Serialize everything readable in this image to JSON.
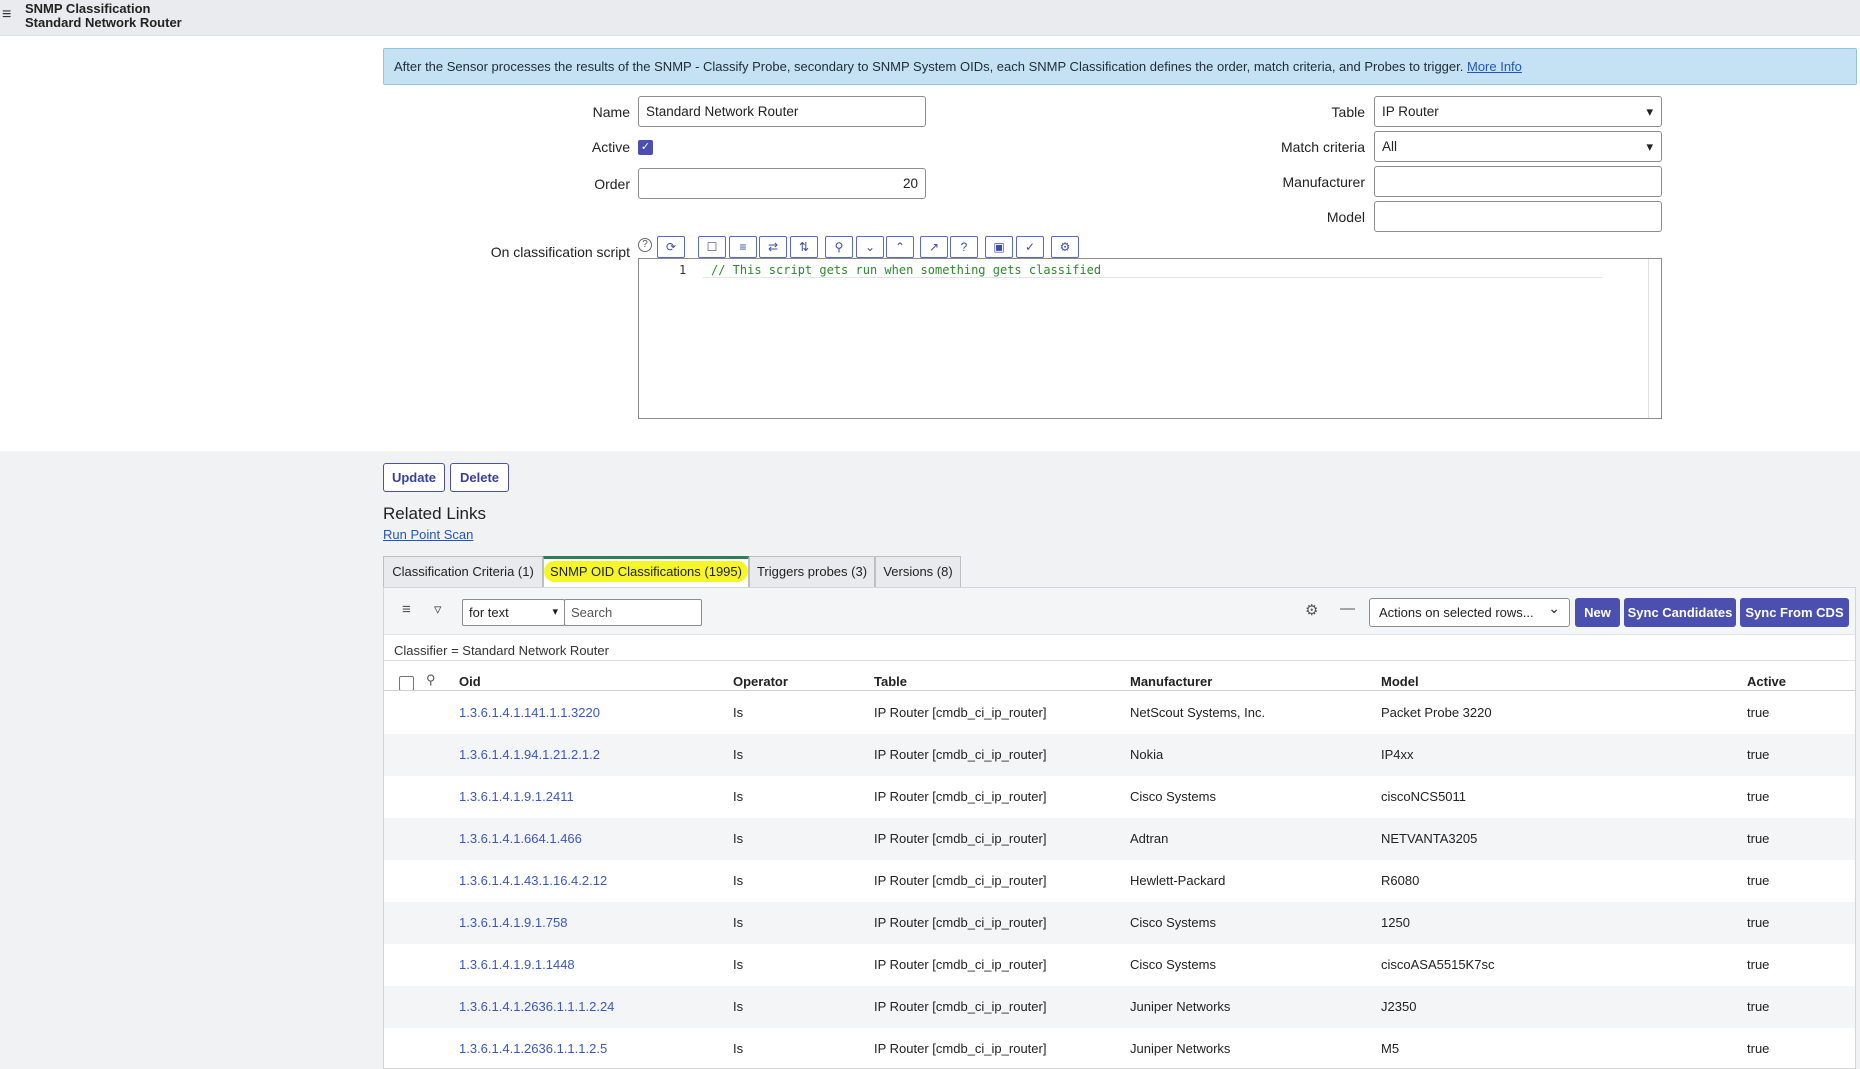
{
  "header": {
    "title": "SNMP Classification",
    "subtitle": "Standard Network Router",
    "menu_icon": "menu-icon"
  },
  "info": {
    "text": "After the Sensor processes the results of the SNMP - Classify Probe, secondary to SNMP System OIDs, each SNMP Classification defines the order, match criteria, and Probes to trigger. ",
    "link": "More Info"
  },
  "form": {
    "name_label": "Name",
    "name_value": "Standard Network Router",
    "active_label": "Active",
    "active_checked": true,
    "order_label": "Order",
    "order_value": "20",
    "table_label": "Table",
    "table_value": "IP Router",
    "match_label": "Match criteria",
    "match_value": "All",
    "manufacturer_label": "Manufacturer",
    "manufacturer_value": "",
    "model_label": "Model",
    "model_value": "",
    "script_label": "On classification script",
    "script_line_number": "1",
    "script_code": "// This script gets run when something gets classified",
    "toolbar_icons": [
      "script-debugger-icon",
      "comment-icon",
      "format-icon",
      "replace-icon",
      "replace-all-icon",
      "search-icon",
      "collapse-icon",
      "expand-icon",
      "fullscreen-icon",
      "help-icon",
      "save-icon",
      "syntax-check-icon",
      "settings-icon"
    ]
  },
  "buttons": {
    "update": "Update",
    "delete": "Delete"
  },
  "related": {
    "title": "Related Links",
    "link": "Run Point Scan"
  },
  "tabs": [
    {
      "label": "Classification Criteria (1)",
      "active": false
    },
    {
      "label": "SNMP OID Classifications (1995)",
      "active": true
    },
    {
      "label": "Triggers probes (3)",
      "active": false
    },
    {
      "label": "Versions (8)",
      "active": false
    }
  ],
  "list": {
    "search_field": "for text",
    "search_placeholder": "Search",
    "actions": "Actions on selected rows...",
    "new": "New",
    "sync_candidates": "Sync Candidates",
    "sync_from_cds": "Sync From CDS",
    "breadcrumb": "Classifier = Standard Network Router",
    "columns": [
      "Oid",
      "Operator",
      "Table",
      "Manufacturer",
      "Model",
      "Active"
    ],
    "rows": [
      {
        "oid": "1.3.6.1.4.1.141.1.1.3220",
        "operator": "Is",
        "table": "IP Router [cmdb_ci_ip_router]",
        "manufacturer": "NetScout Systems, Inc.",
        "model": "Packet Probe 3220",
        "active": "true"
      },
      {
        "oid": "1.3.6.1.4.1.94.1.21.2.1.2",
        "operator": "Is",
        "table": "IP Router [cmdb_ci_ip_router]",
        "manufacturer": "Nokia",
        "model": "IP4xx",
        "active": "true"
      },
      {
        "oid": "1.3.6.1.4.1.9.1.2411",
        "operator": "Is",
        "table": "IP Router [cmdb_ci_ip_router]",
        "manufacturer": "Cisco Systems",
        "model": "ciscoNCS5011",
        "active": "true"
      },
      {
        "oid": "1.3.6.1.4.1.664.1.466",
        "operator": "Is",
        "table": "IP Router [cmdb_ci_ip_router]",
        "manufacturer": "Adtran",
        "model": "NETVANTA3205",
        "active": "true"
      },
      {
        "oid": "1.3.6.1.4.1.43.1.16.4.2.12",
        "operator": "Is",
        "table": "IP Router [cmdb_ci_ip_router]",
        "manufacturer": "Hewlett-Packard",
        "model": "R6080",
        "active": "true"
      },
      {
        "oid": "1.3.6.1.4.1.9.1.758",
        "operator": "Is",
        "table": "IP Router [cmdb_ci_ip_router]",
        "manufacturer": "Cisco Systems",
        "model": "1250",
        "active": "true"
      },
      {
        "oid": "1.3.6.1.4.1.9.1.1448",
        "operator": "Is",
        "table": "IP Router [cmdb_ci_ip_router]",
        "manufacturer": "Cisco Systems",
        "model": "ciscoASA5515K7sc",
        "active": "true"
      },
      {
        "oid": "1.3.6.1.4.1.2636.1.1.1.2.24",
        "operator": "Is",
        "table": "IP Router [cmdb_ci_ip_router]",
        "manufacturer": "Juniper Networks",
        "model": "J2350",
        "active": "true"
      },
      {
        "oid": "1.3.6.1.4.1.2636.1.1.1.2.5",
        "operator": "Is",
        "table": "IP Router [cmdb_ci_ip_router]",
        "manufacturer": "Juniper Networks",
        "model": "M5",
        "active": "true"
      }
    ]
  }
}
